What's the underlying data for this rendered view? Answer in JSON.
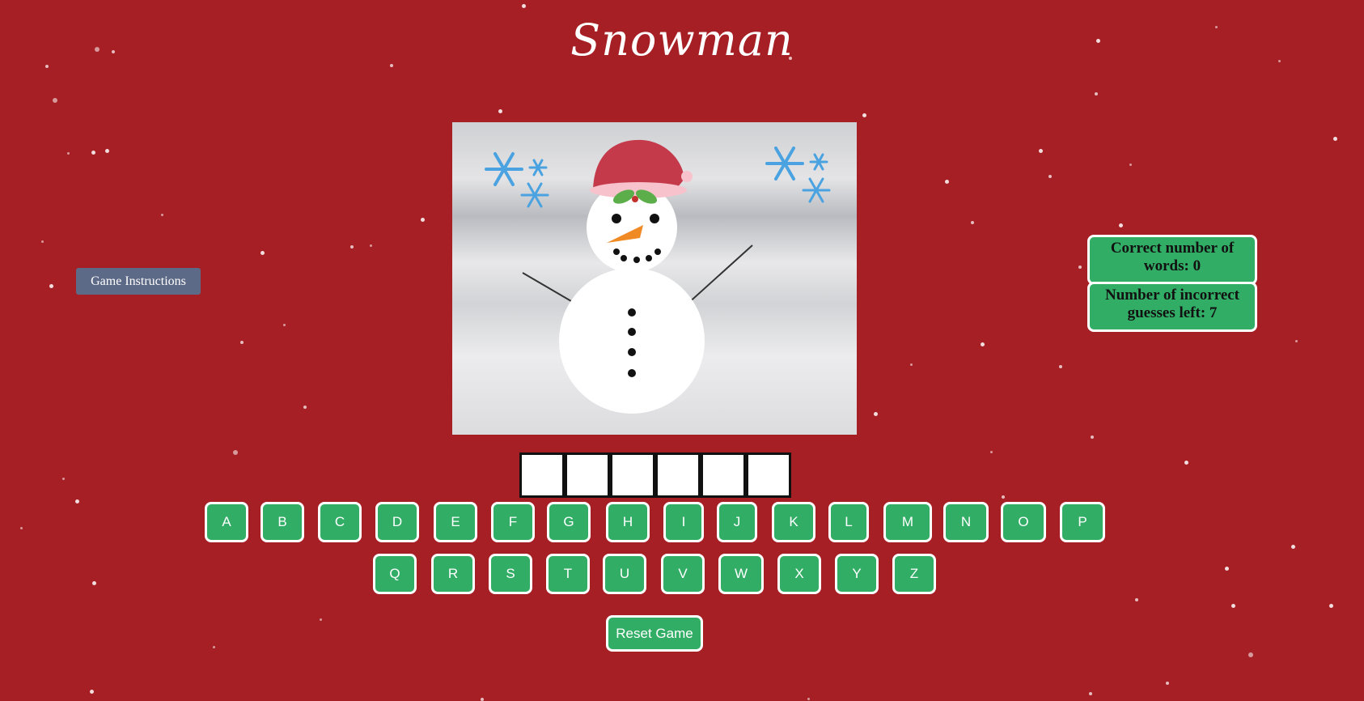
{
  "title": "Snowman",
  "instructions_label": "Game Instructions",
  "stats": {
    "correct_words": "Correct number of words: 0",
    "incorrect_left": "Number of incorrect guesses left: 7"
  },
  "word_slots": [
    "",
    "",
    "",
    "",
    "",
    ""
  ],
  "keyboard": {
    "row1": [
      "A",
      "B",
      "C",
      "D",
      "E",
      "F",
      "G",
      "H",
      "I",
      "J",
      "K",
      "L",
      "M",
      "N",
      "O",
      "P"
    ],
    "row2": [
      "Q",
      "R",
      "S",
      "T",
      "U",
      "V",
      "W",
      "X",
      "Y",
      "Z"
    ]
  },
  "reset_label": "Reset Game",
  "colors": {
    "background": "#a61f24",
    "button_green": "#32ad66",
    "instructions_button": "#5d6a87"
  }
}
